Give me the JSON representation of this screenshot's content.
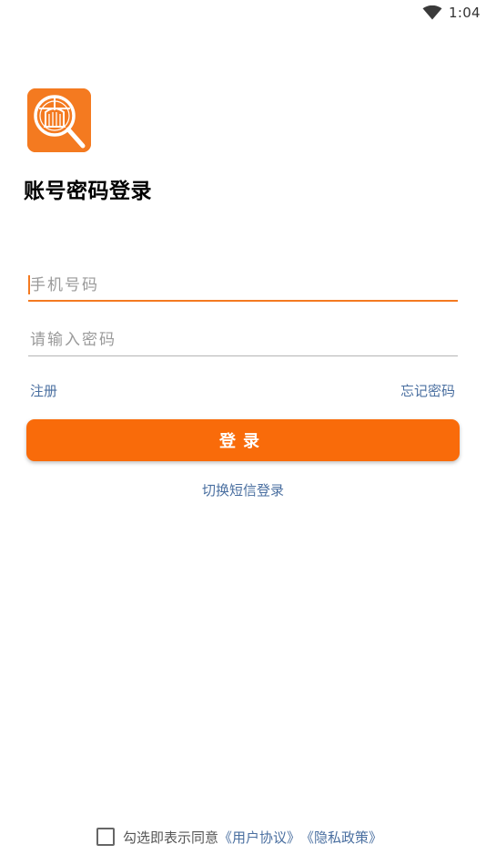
{
  "status_bar": {
    "time": "1:04",
    "wifi_icon": "wifi-icon"
  },
  "logo": {
    "icon": "magnifier-logo-icon",
    "color": "#f47a20"
  },
  "title": "账号密码登录",
  "form": {
    "phone_placeholder": "手机号码",
    "phone_value": "",
    "password_placeholder": "请输入密码",
    "password_value": "",
    "register_label": "注册",
    "forgot_label": "忘记密码",
    "login_label": "登录",
    "sms_switch_label": "切换短信登录"
  },
  "agreement": {
    "checked": false,
    "text": "勾选即表示同意",
    "user_agreement": "《用户协议》",
    "privacy_policy": "《隐私政策》"
  },
  "colors": {
    "accent": "#f96b0a",
    "link": "#4a6fa0"
  }
}
